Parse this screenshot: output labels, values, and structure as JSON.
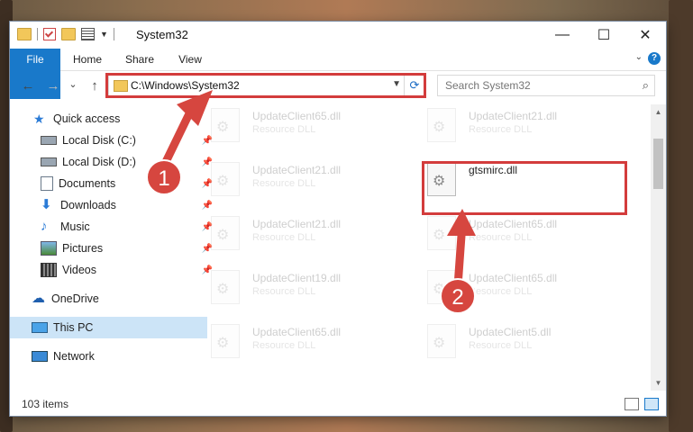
{
  "window": {
    "title": "System32",
    "minimize_glyph": "—",
    "maximize_glyph": "☐",
    "close_glyph": "✕"
  },
  "ribbon": {
    "tabs": [
      "File",
      "Home",
      "Share",
      "View"
    ],
    "help_glyph": "?"
  },
  "nav": {
    "back_glyph": "←",
    "forward_glyph": "→",
    "recent_glyph": "⌄",
    "up_glyph": "↑",
    "address": "C:\\Windows\\System32",
    "search_placeholder": "Search System32"
  },
  "sidebar": {
    "items": [
      {
        "label": "Quick access",
        "icon": "star-icon",
        "pinned": false
      },
      {
        "label": "Local Disk (C:)",
        "icon": "drive-icon",
        "pinned": true
      },
      {
        "label": "Local Disk (D:)",
        "icon": "drive-icon",
        "pinned": true
      },
      {
        "label": "Documents",
        "icon": "documents-icon",
        "pinned": true
      },
      {
        "label": "Downloads",
        "icon": "downloads-icon",
        "pinned": true
      },
      {
        "label": "Music",
        "icon": "music-icon",
        "pinned": true
      },
      {
        "label": "Pictures",
        "icon": "pictures-icon",
        "pinned": true
      },
      {
        "label": "Videos",
        "icon": "videos-icon",
        "pinned": true
      },
      {
        "label": "OneDrive",
        "icon": "cloud-icon",
        "pinned": false
      },
      {
        "label": "This PC",
        "icon": "computer-icon",
        "pinned": false,
        "selected": true
      },
      {
        "label": "Network",
        "icon": "network-icon",
        "pinned": false
      }
    ]
  },
  "files": {
    "left": [
      {
        "name": "UpdateClient65.dll",
        "type": "Resource DLL"
      },
      {
        "name": "UpdateClient21.dll",
        "type": "Resource DLL"
      },
      {
        "name": "UpdateClient21.dll",
        "type": "Resource DLL"
      },
      {
        "name": "UpdateClient19.dll",
        "type": "Resource DLL"
      },
      {
        "name": "UpdateClient65.dll",
        "type": "Resource DLL"
      }
    ],
    "right": [
      {
        "name": "UpdateClient21.dll",
        "type": "Resource DLL"
      },
      {
        "name": "gtsmirc.dll",
        "type": ""
      },
      {
        "name": "UpdateClient65.dll",
        "type": "Resource DLL"
      },
      {
        "name": "UpdateClient65.dll",
        "type": "Resource DLL"
      },
      {
        "name": "UpdateClient5.dll",
        "type": "Resource DLL"
      }
    ]
  },
  "status": {
    "item_count": "103 items"
  },
  "callouts": {
    "one": "1",
    "two": "2"
  },
  "colors": {
    "accent": "#1979ca",
    "annotation": "#d33c3c",
    "selection": "#cce4f7"
  }
}
